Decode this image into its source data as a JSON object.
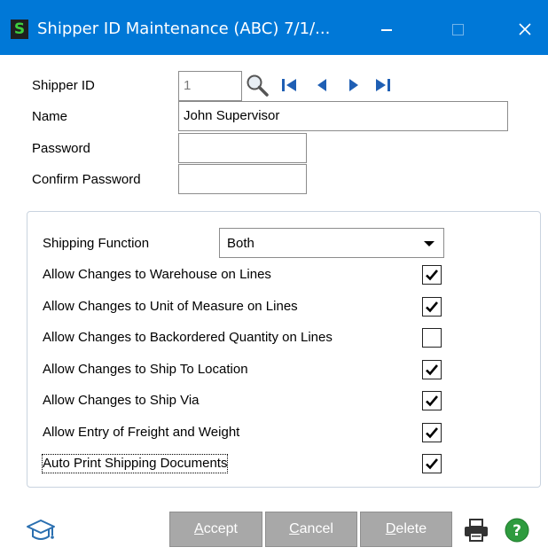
{
  "window": {
    "app_icon_glyph": "S",
    "title": "Shipper ID Maintenance (ABC) 7/1/...",
    "accent_color": "#0078d7"
  },
  "form": {
    "shipper_id": {
      "label": "Shipper ID",
      "value": "1"
    },
    "name": {
      "label": "Name",
      "value": "John Supervisor"
    },
    "password": {
      "label": "Password",
      "value": ""
    },
    "confirm_password": {
      "label": "Confirm Password",
      "value": ""
    }
  },
  "icons": {
    "lookup": "magnifier-icon",
    "first": "first-record-icon",
    "previous": "previous-record-icon",
    "next": "next-record-icon",
    "last": "last-record-icon",
    "help": "graduation-cap-icon",
    "print": "printer-icon",
    "question": "question-mark-icon"
  },
  "options": {
    "shipping_function": {
      "label": "Shipping Function",
      "value": "Both"
    },
    "items": [
      {
        "label": "Allow Changes to Warehouse on Lines",
        "checked": true
      },
      {
        "label": "Allow Changes to Unit of Measure on Lines",
        "checked": true
      },
      {
        "label": "Allow Changes to Backordered Quantity on Lines",
        "checked": false
      },
      {
        "label": "Allow Changes to Ship To Location",
        "checked": true
      },
      {
        "label": "Allow Changes to Ship Via",
        "checked": true
      },
      {
        "label": "Allow Entry of Freight and Weight",
        "checked": true
      },
      {
        "label": "Auto Print Shipping Documents",
        "checked": true
      }
    ]
  },
  "buttons": {
    "accept": {
      "mnemonic": "A",
      "rest": "ccept"
    },
    "cancel": {
      "mnemonic": "C",
      "rest": "ancel"
    },
    "delete": {
      "mnemonic": "D",
      "rest": "elete"
    }
  }
}
